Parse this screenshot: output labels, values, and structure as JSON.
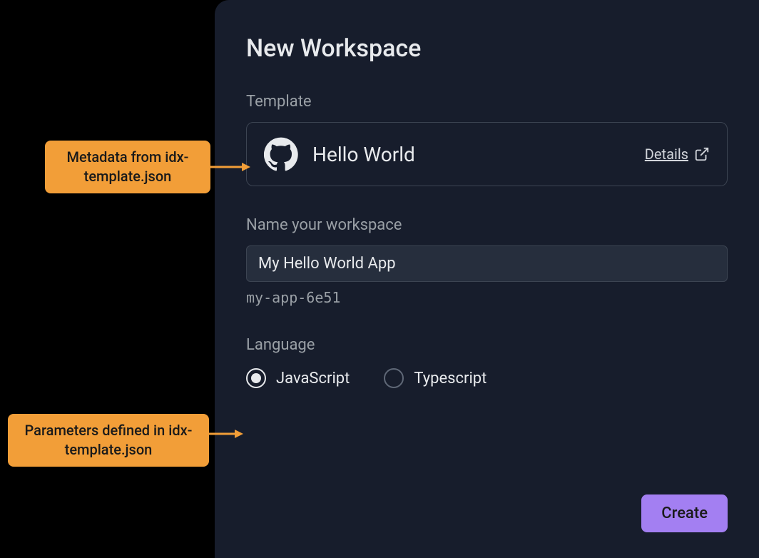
{
  "dialog": {
    "title": "New Workspace",
    "template": {
      "section_label": "Template",
      "name": "Hello World",
      "icon": "github-icon",
      "details_label": "Details"
    },
    "name_workspace": {
      "section_label": "Name your workspace",
      "input_value": "My Hello World App",
      "slug": "my-app-6e51"
    },
    "language": {
      "section_label": "Language",
      "options": [
        {
          "label": "JavaScript",
          "selected": true
        },
        {
          "label": "Typescript",
          "selected": false
        }
      ]
    },
    "create_label": "Create"
  },
  "callouts": {
    "metadata": "Metadata from idx-template.json",
    "parameters": "Parameters defined in idx-template.json"
  },
  "colors": {
    "accent": "#a37ff2",
    "callout_bg": "#f29e38",
    "dialog_bg": "#171d2c"
  }
}
